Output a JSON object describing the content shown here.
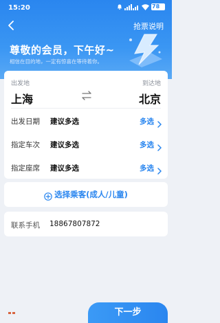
{
  "status_bar": {
    "time": "15:20",
    "battery": "78"
  },
  "nav": {
    "back_icon": "back-chevron-icon",
    "action_label": "抢票说明"
  },
  "hero": {
    "greeting": "尊敬的会员，下午好~",
    "subtitle": "相信在目的地，一定有惊喜在等待着你。",
    "art_icon": "lightning-bolt-icon"
  },
  "route": {
    "from_label": "出发地",
    "from_city": "上海",
    "to_label": "到达地",
    "to_city": "北京",
    "swap_icon": "swap-arrows-icon"
  },
  "options": [
    {
      "label": "出发日期",
      "value": "建议多选",
      "action": "多选"
    },
    {
      "label": "指定车次",
      "value": "建议多选",
      "action": "多选"
    },
    {
      "label": "指定座席",
      "value": "建议多选",
      "action": "多选"
    }
  ],
  "passenger": {
    "label": "选择乘客(成人/儿童)",
    "icon": "plus-circle-icon"
  },
  "contact": {
    "label": "联系手机",
    "value": "18867807872"
  },
  "footer": {
    "next_label": "下一步"
  },
  "colors": {
    "accent": "#2a86ef",
    "background": "#eef1f6"
  }
}
